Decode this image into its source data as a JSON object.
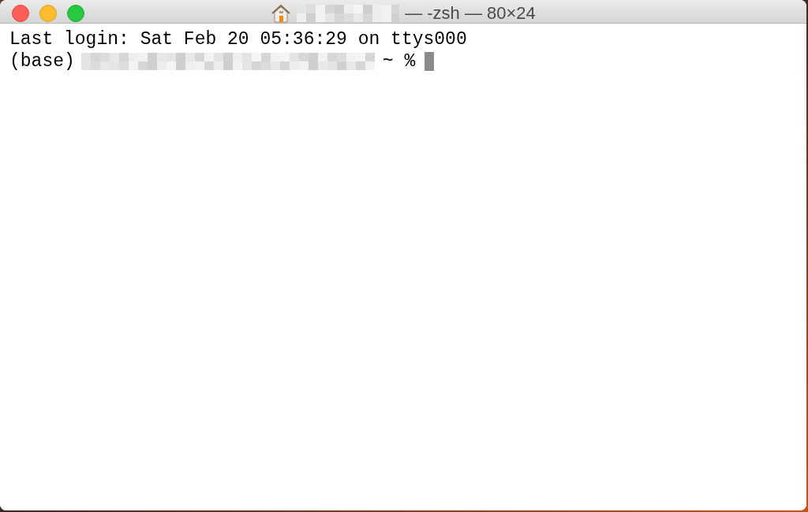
{
  "window": {
    "title_suffix": "— -zsh — 80×24"
  },
  "terminal": {
    "lines": [
      {
        "kind": "text",
        "text": "Last login: Sat Feb 20 05:36:29 on ttys000"
      },
      {
        "kind": "prompt",
        "prefix": "(base)",
        "suffix": "~ %",
        "cursor": true
      }
    ]
  }
}
